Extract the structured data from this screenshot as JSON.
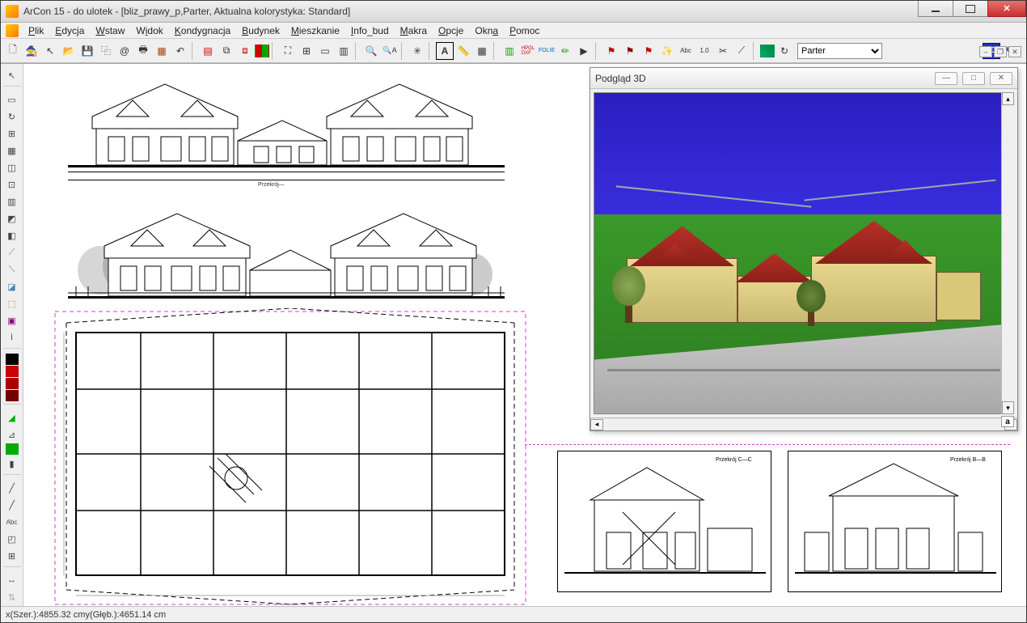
{
  "window": {
    "title": "ArCon 15 - do ulotek - [bliz_prawy_p,Parter, Aktualna kolorystyka: Standard]"
  },
  "menu": {
    "items": [
      {
        "label": "Plik",
        "ul": "P"
      },
      {
        "label": "Edycja",
        "ul": "E"
      },
      {
        "label": "Wstaw",
        "ul": "W"
      },
      {
        "label": "Widok",
        "ul": "W"
      },
      {
        "label": "Kondygnacja",
        "ul": "K"
      },
      {
        "label": "Budynek",
        "ul": "B"
      },
      {
        "label": "Mieszkanie",
        "ul": "M"
      },
      {
        "label": "Info_bud",
        "ul": "I"
      },
      {
        "label": "Makra",
        "ul": "M"
      },
      {
        "label": "Opcje",
        "ul": "O"
      },
      {
        "label": "Okna",
        "ul": "O"
      },
      {
        "label": "Pomoc",
        "ul": "P"
      }
    ]
  },
  "toolbar": {
    "floor_selector": "Parter",
    "btn_3d": "3D",
    "btn_help": "?"
  },
  "left_tools": {
    "labels": [
      "↖",
      "▭",
      "↻",
      "⊞",
      "▦",
      "◫",
      "⊡",
      "▥",
      "◩",
      "◧",
      "⟋",
      "⟍",
      "◪",
      "⬚",
      "▣",
      "i",
      "⬛",
      "■",
      "■",
      "■",
      "◢",
      "⊿",
      "⫿",
      "▮",
      "/",
      "/",
      "Abc",
      "◰",
      "⊞",
      "↔",
      "⇅"
    ]
  },
  "preview3d": {
    "title": "Podgląd 3D",
    "corner_a": "a"
  },
  "status": {
    "coords_label_x": "x(Szer.): ",
    "coords_x": "4855.32 cm",
    "coords_label_y": "  y(Głęb.): ",
    "coords_y": "4651.14 cm"
  },
  "drawings": {
    "section_label_top": "Przekrój—",
    "section_label_right1": "Przekrój C—C",
    "section_label_right2": "Przekrój B—B"
  }
}
